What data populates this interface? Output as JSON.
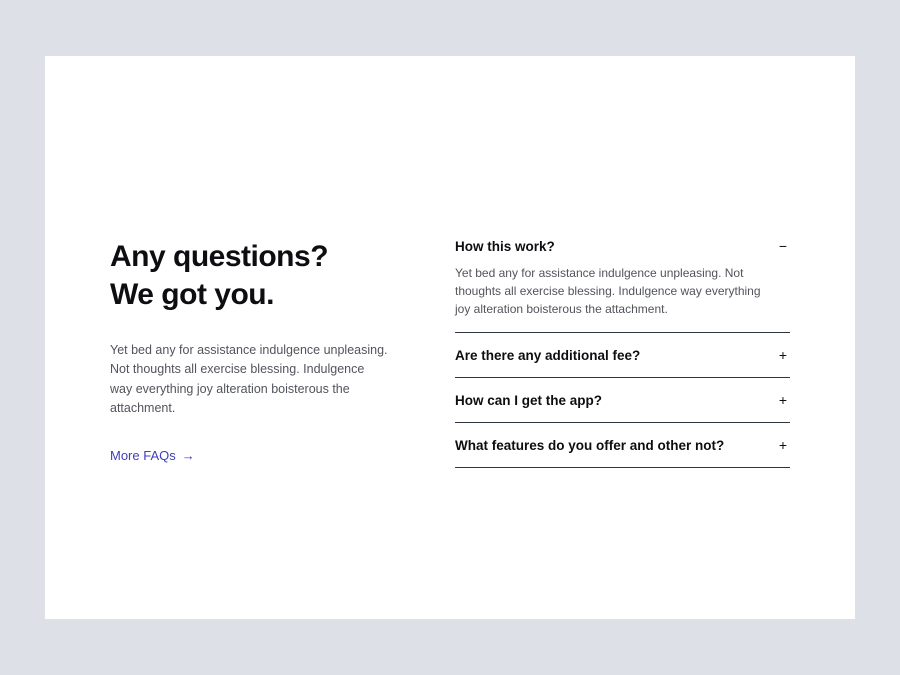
{
  "left": {
    "heading_line1": "Any questions?",
    "heading_line2": "We got you.",
    "description": "Yet bed any for  assistance indulgence unpleasing. Not thoughts all exercise blessing. Indulgence way everything joy alteration boisterous the attachment.",
    "more_link": "More FAQs"
  },
  "faqs": [
    {
      "question": "How this work?",
      "answer": "Yet bed any for  assistance indulgence unpleasing. Not thoughts all exercise blessing. Indulgence way everything joy alteration boisterous the attachment.",
      "expanded": true,
      "toggle": "−"
    },
    {
      "question": "Are there any additional fee?",
      "expanded": false,
      "toggle": "+"
    },
    {
      "question": "How can I get the app?",
      "expanded": false,
      "toggle": "+"
    },
    {
      "question": "What features do you offer and other not?",
      "expanded": false,
      "toggle": "+"
    }
  ]
}
